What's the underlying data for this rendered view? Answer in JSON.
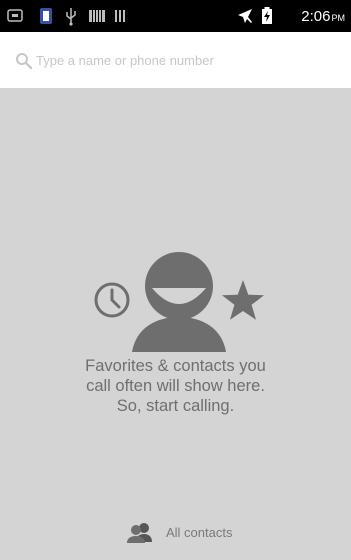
{
  "status_bar": {
    "time": "2:06",
    "ampm": "PM",
    "icons": [
      "notification-icon",
      "app-icon",
      "usb-icon",
      "barcode-icon",
      "signal-bars-icon",
      "airplane-mode-icon",
      "battery-charging-icon"
    ]
  },
  "search": {
    "placeholder": "Type a name or phone number",
    "value": ""
  },
  "empty_state": {
    "icons": [
      "clock-icon",
      "person-icon",
      "star-icon"
    ],
    "message_lines": [
      "Favorites & contacts you",
      "call often will show here.",
      "So, start calling."
    ]
  },
  "footer": {
    "all_contacts_label": "All contacts",
    "icon": "contacts-icon"
  },
  "colors": {
    "status_bar": "#000000",
    "background": "#d4d4d4",
    "search_background": "#ffffff",
    "illustration": "#6e6e6e",
    "text": "#6f6f6f"
  }
}
